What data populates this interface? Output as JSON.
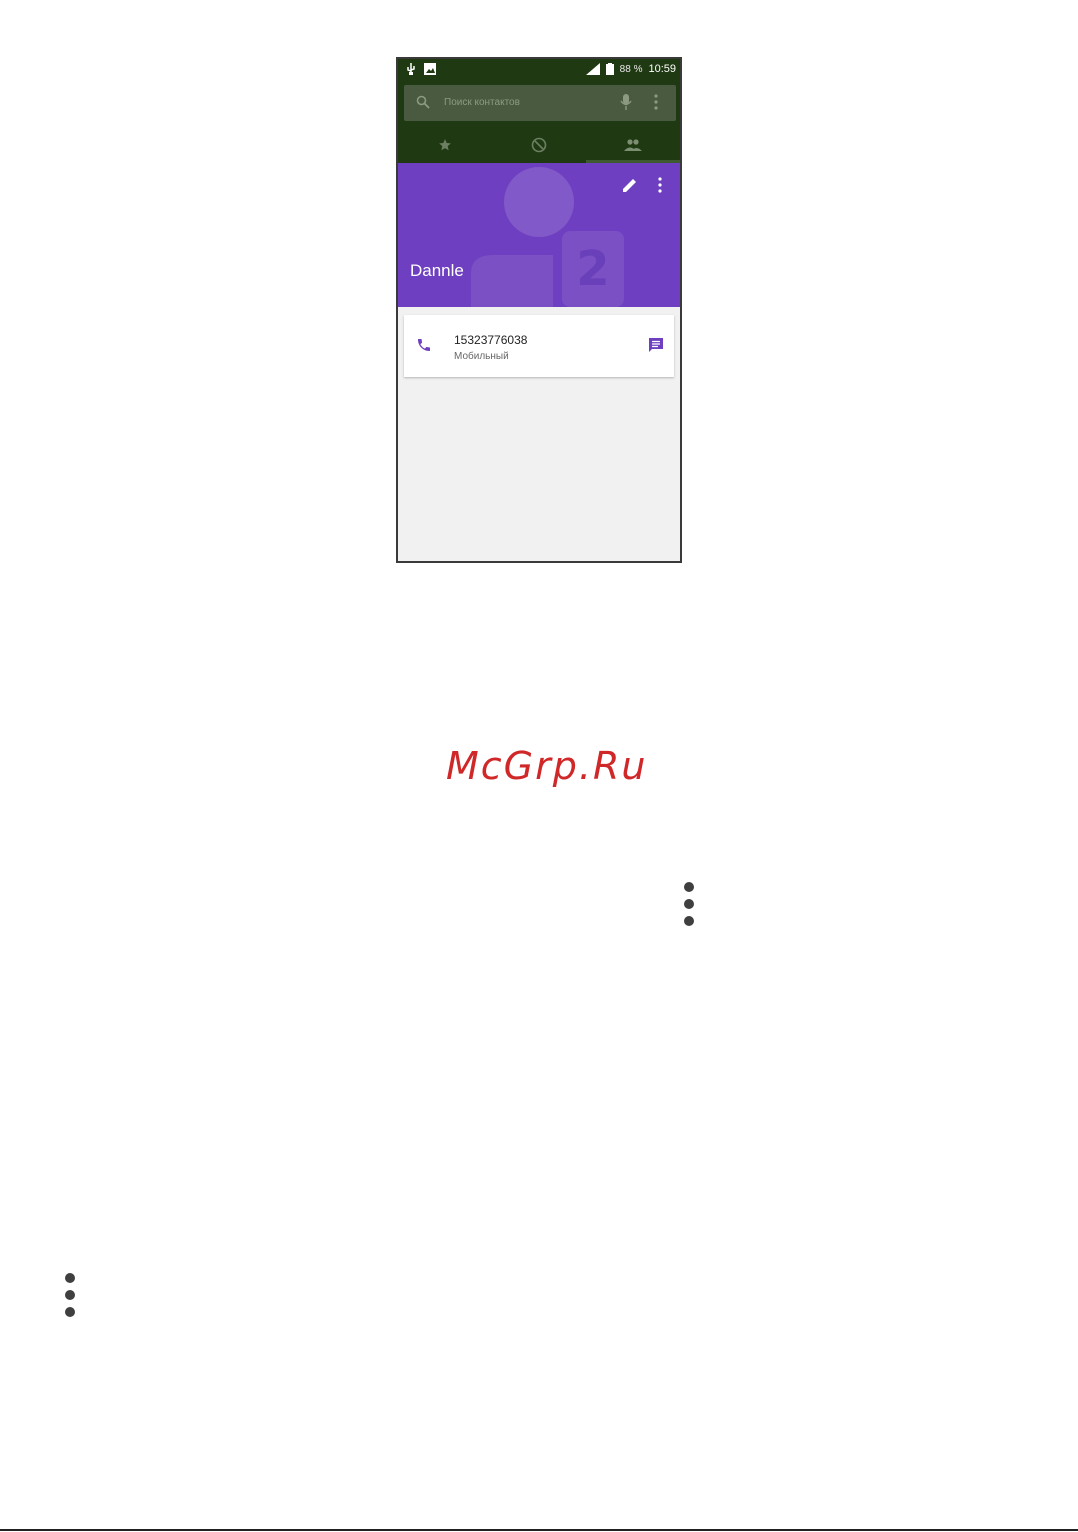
{
  "status_bar": {
    "battery": "88 %",
    "time": "10:59"
  },
  "search": {
    "placeholder": "Поиск контактов"
  },
  "tabs": [
    {
      "icon": "star-icon"
    },
    {
      "icon": "clock-icon"
    },
    {
      "icon": "people-icon",
      "selected": true
    }
  ],
  "contact": {
    "name": "Dannle",
    "phone_number": "15323776038",
    "phone_type": "Мобильный"
  },
  "watermark": "McGrp.Ru",
  "colors": {
    "app_bar": "#1f3a12",
    "header": "#6e3fc0",
    "accent": "#6e3fc0",
    "watermark": "#d02828"
  }
}
